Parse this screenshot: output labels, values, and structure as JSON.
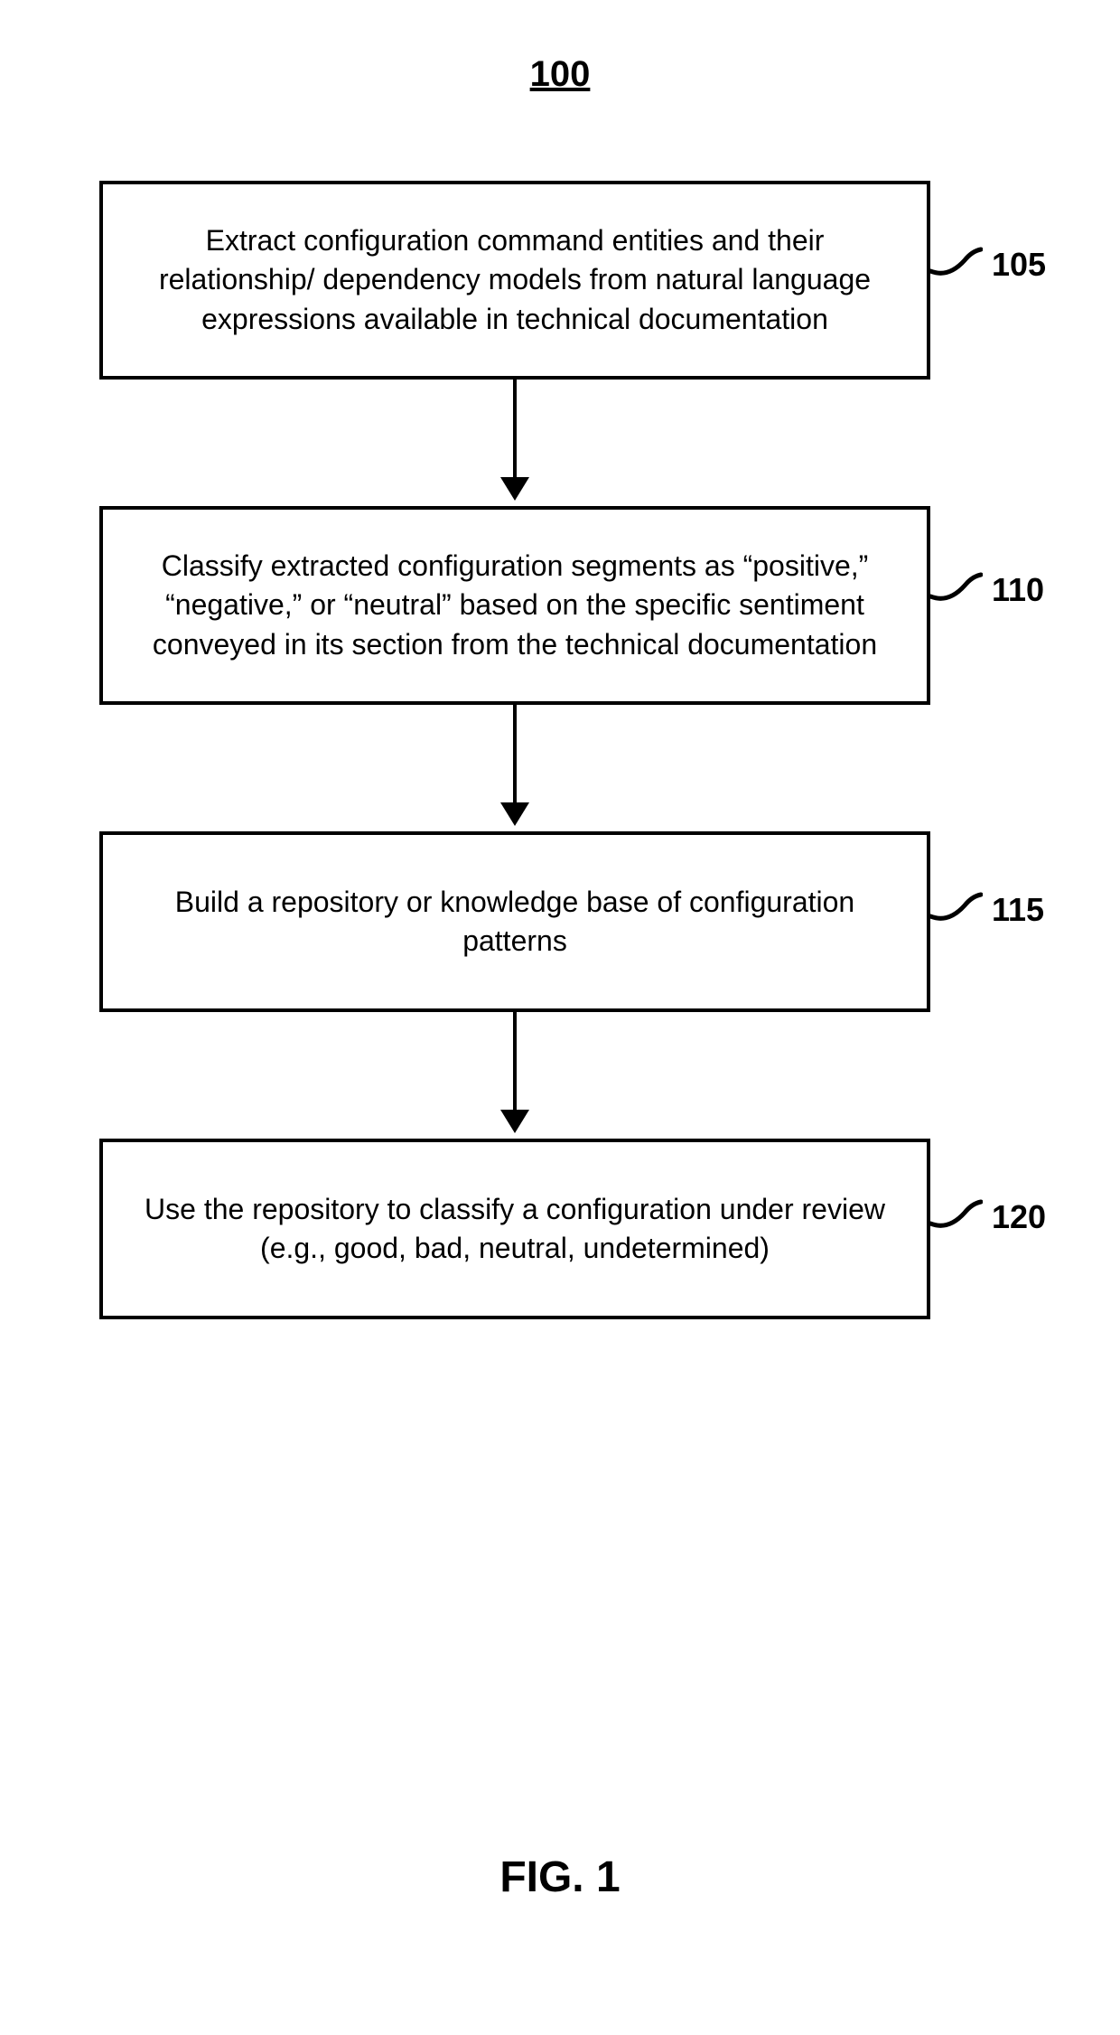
{
  "title": "100",
  "figure_label": "FIG. 1",
  "steps": [
    {
      "ref": "105",
      "text": "Extract configuration command entities and their relationship/ dependency models from natural language expressions available in technical documentation"
    },
    {
      "ref": "110",
      "text": "Classify extracted configuration segments as “positive,” “negative,” or “neutral” based on the specific sentiment conveyed in its section from the technical documentation"
    },
    {
      "ref": "115",
      "text": "Build a repository or knowledge base of configuration patterns"
    },
    {
      "ref": "120",
      "text": "Use the repository to classify a configuration under review (e.g., good, bad, neutral, undetermined)"
    }
  ]
}
